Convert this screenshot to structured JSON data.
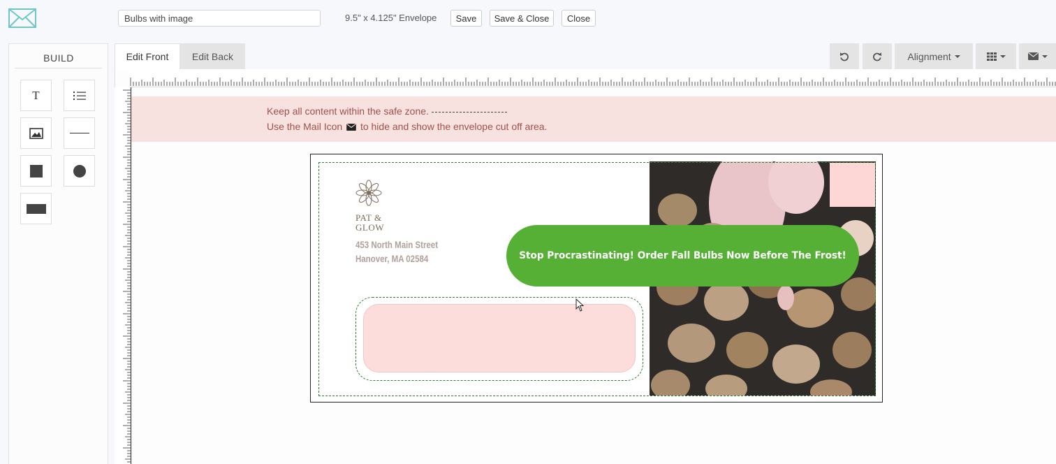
{
  "header": {
    "document_name": "Bulbs with image",
    "envelope_size": "9.5\" x 4.125\" Envelope",
    "save_label": "Save",
    "save_close_label": "Save & Close",
    "close_label": "Close",
    "logo_icon": "envelope-logo-icon"
  },
  "build_panel": {
    "title": "BUILD",
    "tools": [
      {
        "name": "text-tool",
        "icon": "text-icon",
        "glyph": "T"
      },
      {
        "name": "list-tool",
        "icon": "list-icon"
      },
      {
        "name": "image-tool",
        "icon": "image-icon"
      },
      {
        "name": "line-tool",
        "icon": "line-icon"
      },
      {
        "name": "square-tool",
        "icon": "square-icon"
      },
      {
        "name": "circle-tool",
        "icon": "circle-icon"
      },
      {
        "name": "rectangle-tool",
        "icon": "rectangle-icon"
      }
    ]
  },
  "tabs": {
    "front": "Edit Front",
    "back": "Edit Back",
    "active": "front"
  },
  "toolbar": {
    "undo_icon": "undo-icon",
    "redo_icon": "redo-icon",
    "alignment_label": "Alignment",
    "grid_icon": "grid-icon",
    "mail_icon": "mail-icon"
  },
  "notice": {
    "line1": "Keep all content within the safe zone.",
    "line2_before": "Use the Mail Icon",
    "line2_after": "to hide and show the envelope cut off area."
  },
  "envelope": {
    "brand_line1": "PAT &",
    "brand_line2": "GLOW",
    "address_line1": "453 North Main Street",
    "address_line2": "Hanover, MA 02584",
    "banner_text": "Stop Procrastinating! Order Fall Bulbs Now Before The Frost!"
  },
  "colors": {
    "banner_green": "#56b035",
    "safe_zone": "#2e7d32",
    "window_pink": "#fddcdc",
    "notice_bg": "#f7e2e0",
    "notice_text": "#a0504a"
  }
}
